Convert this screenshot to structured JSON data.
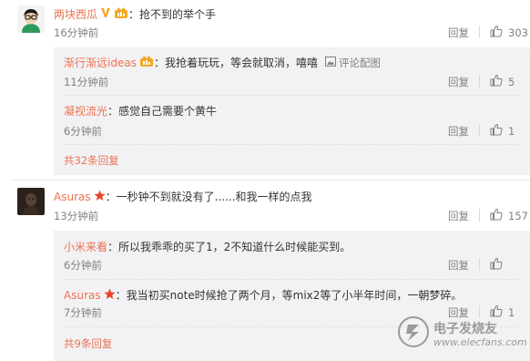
{
  "comments": [
    {
      "author": "两块西瓜",
      "colon": "：",
      "text": "抢不到的举个手",
      "time": "16分钟前",
      "reply_label": "回复",
      "likes": "303",
      "replies": [
        {
          "author": "渐行渐远ideas",
          "colon": "：",
          "text": "我抢着玩玩，等会就取消，嘻嘻",
          "extra": "评论配图",
          "time": "11分钟前",
          "reply_label": "回复",
          "likes": "5"
        },
        {
          "author": "凝视流光",
          "colon": "：",
          "text": "感觉自己需要个黄牛",
          "time": "6分钟前",
          "reply_label": "回复",
          "likes": "1"
        }
      ],
      "more": "共32条回复"
    },
    {
      "author": "Asuras",
      "colon": "：",
      "text": "一秒钟不到就没有了......和我一样的点我",
      "time": "13分钟前",
      "reply_label": "回复",
      "likes": "157",
      "replies": [
        {
          "author": "小米来看",
          "colon": "：",
          "text": "所以我乖乖的买了1，2不知道什么时候能买到。",
          "time": "6分钟前",
          "reply_label": "回复",
          "likes": ""
        },
        {
          "author": "Asuras",
          "colon": "：",
          "text": "我当初买note时候抢了两个月，等mix2等了小半年时间，一朝梦碎。",
          "time": "7分钟前",
          "reply_label": "回复",
          "likes": "1"
        }
      ],
      "more": "共9条回复"
    }
  ],
  "watermark": {
    "cn": "电子发烧友",
    "en": "www.elecfans.com"
  },
  "colors": {
    "name": "#eb7350",
    "muted": "#808080",
    "reply_bg": "#f2f2f5"
  }
}
